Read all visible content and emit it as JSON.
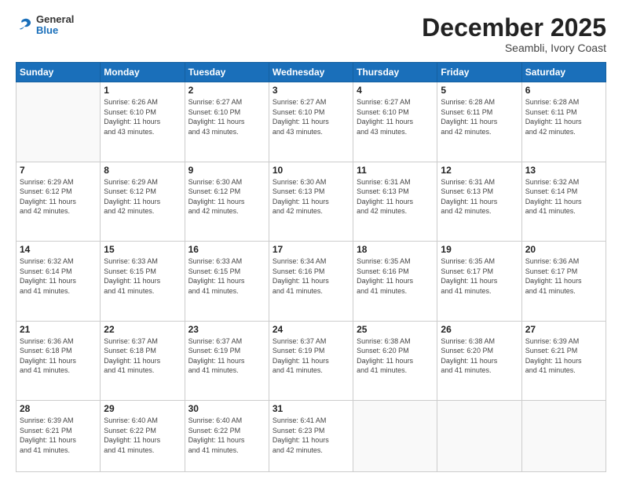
{
  "header": {
    "logo_general": "General",
    "logo_blue": "Blue",
    "month_title": "December 2025",
    "subtitle": "Seambli, Ivory Coast"
  },
  "weekdays": [
    "Sunday",
    "Monday",
    "Tuesday",
    "Wednesday",
    "Thursday",
    "Friday",
    "Saturday"
  ],
  "weeks": [
    [
      {
        "day": "",
        "info": ""
      },
      {
        "day": "1",
        "info": "Sunrise: 6:26 AM\nSunset: 6:10 PM\nDaylight: 11 hours\nand 43 minutes."
      },
      {
        "day": "2",
        "info": "Sunrise: 6:27 AM\nSunset: 6:10 PM\nDaylight: 11 hours\nand 43 minutes."
      },
      {
        "day": "3",
        "info": "Sunrise: 6:27 AM\nSunset: 6:10 PM\nDaylight: 11 hours\nand 43 minutes."
      },
      {
        "day": "4",
        "info": "Sunrise: 6:27 AM\nSunset: 6:10 PM\nDaylight: 11 hours\nand 43 minutes."
      },
      {
        "day": "5",
        "info": "Sunrise: 6:28 AM\nSunset: 6:11 PM\nDaylight: 11 hours\nand 42 minutes."
      },
      {
        "day": "6",
        "info": "Sunrise: 6:28 AM\nSunset: 6:11 PM\nDaylight: 11 hours\nand 42 minutes."
      }
    ],
    [
      {
        "day": "7",
        "info": "Sunrise: 6:29 AM\nSunset: 6:12 PM\nDaylight: 11 hours\nand 42 minutes."
      },
      {
        "day": "8",
        "info": "Sunrise: 6:29 AM\nSunset: 6:12 PM\nDaylight: 11 hours\nand 42 minutes."
      },
      {
        "day": "9",
        "info": "Sunrise: 6:30 AM\nSunset: 6:12 PM\nDaylight: 11 hours\nand 42 minutes."
      },
      {
        "day": "10",
        "info": "Sunrise: 6:30 AM\nSunset: 6:13 PM\nDaylight: 11 hours\nand 42 minutes."
      },
      {
        "day": "11",
        "info": "Sunrise: 6:31 AM\nSunset: 6:13 PM\nDaylight: 11 hours\nand 42 minutes."
      },
      {
        "day": "12",
        "info": "Sunrise: 6:31 AM\nSunset: 6:13 PM\nDaylight: 11 hours\nand 42 minutes."
      },
      {
        "day": "13",
        "info": "Sunrise: 6:32 AM\nSunset: 6:14 PM\nDaylight: 11 hours\nand 41 minutes."
      }
    ],
    [
      {
        "day": "14",
        "info": "Sunrise: 6:32 AM\nSunset: 6:14 PM\nDaylight: 11 hours\nand 41 minutes."
      },
      {
        "day": "15",
        "info": "Sunrise: 6:33 AM\nSunset: 6:15 PM\nDaylight: 11 hours\nand 41 minutes."
      },
      {
        "day": "16",
        "info": "Sunrise: 6:33 AM\nSunset: 6:15 PM\nDaylight: 11 hours\nand 41 minutes."
      },
      {
        "day": "17",
        "info": "Sunrise: 6:34 AM\nSunset: 6:16 PM\nDaylight: 11 hours\nand 41 minutes."
      },
      {
        "day": "18",
        "info": "Sunrise: 6:35 AM\nSunset: 6:16 PM\nDaylight: 11 hours\nand 41 minutes."
      },
      {
        "day": "19",
        "info": "Sunrise: 6:35 AM\nSunset: 6:17 PM\nDaylight: 11 hours\nand 41 minutes."
      },
      {
        "day": "20",
        "info": "Sunrise: 6:36 AM\nSunset: 6:17 PM\nDaylight: 11 hours\nand 41 minutes."
      }
    ],
    [
      {
        "day": "21",
        "info": "Sunrise: 6:36 AM\nSunset: 6:18 PM\nDaylight: 11 hours\nand 41 minutes."
      },
      {
        "day": "22",
        "info": "Sunrise: 6:37 AM\nSunset: 6:18 PM\nDaylight: 11 hours\nand 41 minutes."
      },
      {
        "day": "23",
        "info": "Sunrise: 6:37 AM\nSunset: 6:19 PM\nDaylight: 11 hours\nand 41 minutes."
      },
      {
        "day": "24",
        "info": "Sunrise: 6:37 AM\nSunset: 6:19 PM\nDaylight: 11 hours\nand 41 minutes."
      },
      {
        "day": "25",
        "info": "Sunrise: 6:38 AM\nSunset: 6:20 PM\nDaylight: 11 hours\nand 41 minutes."
      },
      {
        "day": "26",
        "info": "Sunrise: 6:38 AM\nSunset: 6:20 PM\nDaylight: 11 hours\nand 41 minutes."
      },
      {
        "day": "27",
        "info": "Sunrise: 6:39 AM\nSunset: 6:21 PM\nDaylight: 11 hours\nand 41 minutes."
      }
    ],
    [
      {
        "day": "28",
        "info": "Sunrise: 6:39 AM\nSunset: 6:21 PM\nDaylight: 11 hours\nand 41 minutes."
      },
      {
        "day": "29",
        "info": "Sunrise: 6:40 AM\nSunset: 6:22 PM\nDaylight: 11 hours\nand 41 minutes."
      },
      {
        "day": "30",
        "info": "Sunrise: 6:40 AM\nSunset: 6:22 PM\nDaylight: 11 hours\nand 41 minutes."
      },
      {
        "day": "31",
        "info": "Sunrise: 6:41 AM\nSunset: 6:23 PM\nDaylight: 11 hours\nand 42 minutes."
      },
      {
        "day": "",
        "info": ""
      },
      {
        "day": "",
        "info": ""
      },
      {
        "day": "",
        "info": ""
      }
    ]
  ]
}
